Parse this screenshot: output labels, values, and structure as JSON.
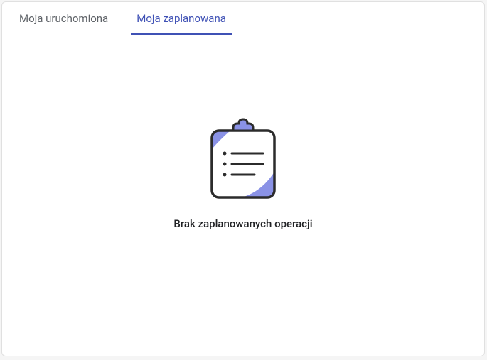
{
  "tabs": [
    {
      "label": "Moja uruchomiona"
    },
    {
      "label": "Moja zaplanowana"
    }
  ],
  "empty_state": {
    "message": "Brak zaplanowanych operacji"
  }
}
